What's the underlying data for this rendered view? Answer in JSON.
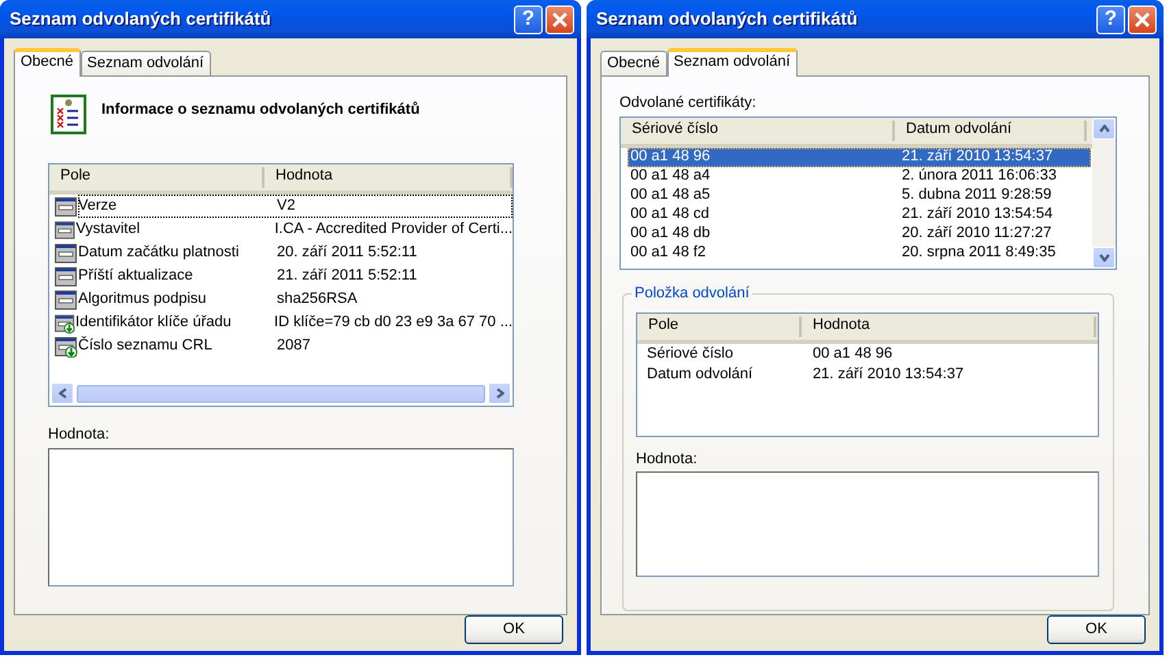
{
  "dialogs": [
    {
      "title": "Seznam odvolaných certifikátů",
      "help_button": "?",
      "tabs": [
        {
          "label": "Obecné",
          "selected": true
        },
        {
          "label": "Seznam odvolání",
          "selected": false
        }
      ],
      "panel": {
        "kind": "general",
        "heading": "Informace o seznamu odvolaných certifikátů",
        "fields_list": {
          "columns": [
            "Pole",
            "Hodnota"
          ],
          "rows": [
            {
              "kind": "standard",
              "field": "Verze",
              "value": "V2",
              "focused": true
            },
            {
              "kind": "standard",
              "field": "Vystavitel",
              "value": "I.CA - Accredited Provider of Certi...",
              "focused": false
            },
            {
              "kind": "standard",
              "field": "Datum začátku platnosti",
              "value": "20. září 2011 5:52:11",
              "focused": false
            },
            {
              "kind": "standard",
              "field": "Příští aktualizace",
              "value": "21. září 2011 5:52:11",
              "focused": false
            },
            {
              "kind": "standard",
              "field": "Algoritmus podpisu",
              "value": "sha256RSA",
              "focused": false
            },
            {
              "kind": "extension",
              "field": "Identifikátor klíče úřadu",
              "value": "ID klíče=79 cb d0 23 e9 3a 67 70 ...",
              "focused": false
            },
            {
              "kind": "extension",
              "field": "Číslo seznamu CRL",
              "value": "2087",
              "focused": false
            }
          ]
        },
        "value_label": "Hodnota:"
      },
      "ok_button": "OK"
    },
    {
      "title": "Seznam odvolaných certifikátů",
      "help_button": "?",
      "tabs": [
        {
          "label": "Obecné",
          "selected": false
        },
        {
          "label": "Seznam odvolání",
          "selected": true
        }
      ],
      "panel": {
        "kind": "revocation_list",
        "list_label": "Odvolané certifikáty:",
        "revoked_list": {
          "columns": [
            "Sériové číslo",
            "Datum odvolání"
          ],
          "rows": [
            {
              "serial": "00 a1 48 96",
              "date": "21. září 2010 13:54:37",
              "selected": true
            },
            {
              "serial": "00 a1 48 a4",
              "date": "2. února 2011 16:06:33",
              "selected": false
            },
            {
              "serial": "00 a1 48 a5",
              "date": "5. dubna 2011 9:28:59",
              "selected": false
            },
            {
              "serial": "00 a1 48 cd",
              "date": "21. září 2010 13:54:54",
              "selected": false
            },
            {
              "serial": "00 a1 48 db",
              "date": "20. září 2010 11:27:27",
              "selected": false
            },
            {
              "serial": "00 a1 48 f2",
              "date": "20. srpna 2011 8:49:35",
              "selected": false
            }
          ]
        },
        "entry_group": {
          "title": "Položka odvolání",
          "columns": [
            "Pole",
            "Hodnota"
          ],
          "rows": [
            {
              "field": "Sériové číslo",
              "value": "00 a1 48 96"
            },
            {
              "field": "Datum odvolání",
              "value": "21. září 2010 13:54:37"
            }
          ],
          "value_label": "Hodnota:"
        }
      },
      "ok_button": "OK"
    }
  ]
}
